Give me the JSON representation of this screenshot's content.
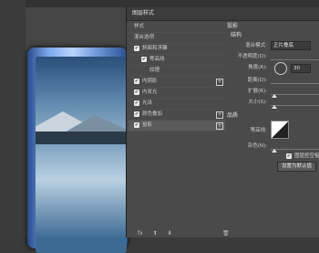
{
  "dialog": {
    "title": "图层样式"
  },
  "styles_list": {
    "items": [
      {
        "label": "样式",
        "checkbox": false,
        "plus": false
      },
      {
        "label": "混合选项",
        "checkbox": false,
        "plus": false
      },
      {
        "label": "斜面和浮雕",
        "checkbox": true,
        "plus": false
      },
      {
        "label": "等高线",
        "checkbox": true,
        "plus": false,
        "indent": true
      },
      {
        "label": "纹理",
        "checkbox": false,
        "plus": false,
        "indent": true
      },
      {
        "label": "内阴影",
        "checkbox": true,
        "plus": true
      },
      {
        "label": "内发光",
        "checkbox": true,
        "plus": false
      },
      {
        "label": "光泽",
        "checkbox": true,
        "plus": false
      },
      {
        "label": "颜色叠加",
        "checkbox": true,
        "plus": true
      },
      {
        "label": "投影",
        "checkbox": true,
        "plus": true,
        "selected": true
      }
    ],
    "bottom_icons": [
      "fx",
      "up-icon",
      "down-icon"
    ]
  },
  "right_panel": {
    "section_title": "投影",
    "sub_title": "结构",
    "blend_mode_label": "混合模式:",
    "blend_mode_value": "正片叠底",
    "opacity_label": "不透明度(O):",
    "angle_label": "角度(A):",
    "angle_value": "30",
    "distance_label": "距离(D):",
    "spread_label": "扩展(R):",
    "size_label": "大小(S):",
    "quality_title": "品质",
    "contour_label": "等高线:",
    "noise_label": "杂色(N):",
    "knockout_label": "图层挖空投影",
    "default_button": "设置为默认值"
  }
}
